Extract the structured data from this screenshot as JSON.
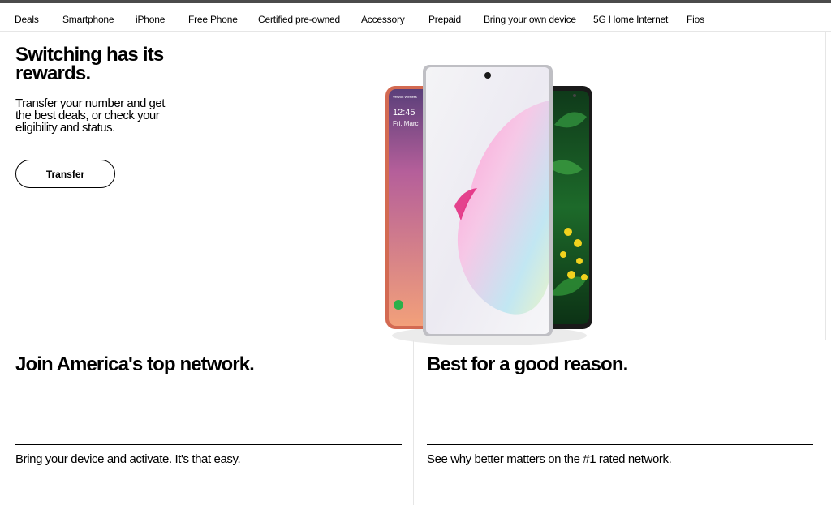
{
  "nav": {
    "items": [
      "Deals",
      "Smartphone",
      "iPhone",
      "Free Phone",
      "Certified pre-owned",
      "Accessory",
      "Prepaid",
      "Bring your own device",
      "5G Home Internet",
      "Fios"
    ]
  },
  "hero": {
    "title": "Switching has its rewards.",
    "subtitle": "Transfer your number and get the best deals, or check your eligibility and status.",
    "button_label": "Transfer",
    "phone_time": "12:45",
    "phone_date": "Fri, Marc",
    "phone_carrier": "Verizon Wireless"
  },
  "cards": [
    {
      "title": "Join America's top network.",
      "text": "Bring your device and activate. It's that easy."
    },
    {
      "title": "Best for a good reason.",
      "text": "See why better matters on the #1 rated network."
    }
  ],
  "colors": {
    "border": "#e6e6e6",
    "topbar": "#4b4b4b",
    "text": "#000000"
  }
}
